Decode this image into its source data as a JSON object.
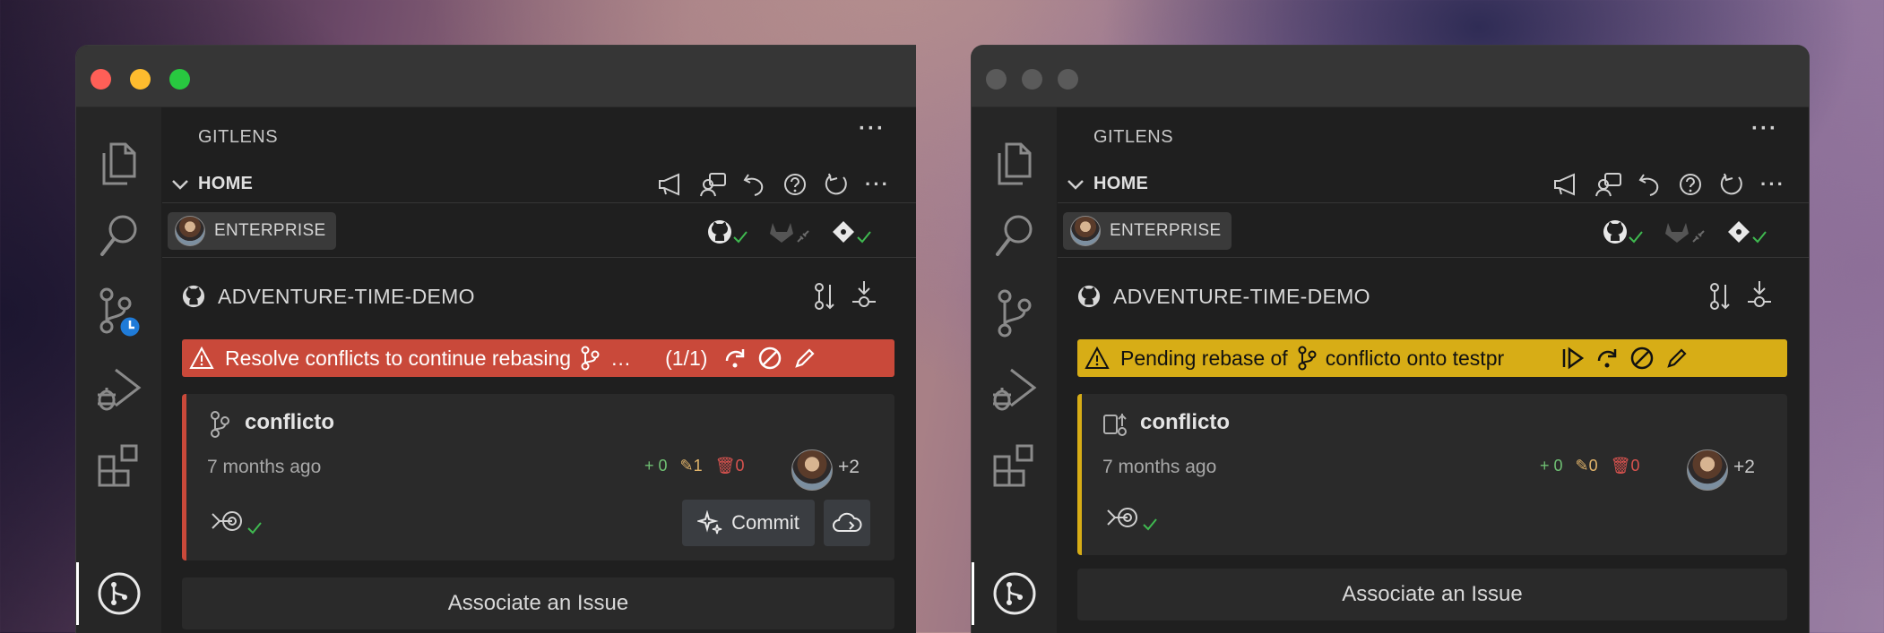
{
  "windows": [
    {
      "panel_title": "GITLENS",
      "section_label": "HOME",
      "account_label": "ENTERPRISE",
      "repo_name": "ADVENTURE-TIME-DEMO",
      "banner": {
        "text": "Resolve conflicts to continue rebasing",
        "extra": "…",
        "count": "(1/1)",
        "color": "#c9493a"
      },
      "branch": {
        "name": "conflicto",
        "time": "7 months ago",
        "added": "0",
        "modified": "1",
        "deleted": "0",
        "more": "+2"
      },
      "commit_label": "Commit",
      "associate_label": "Associate an Issue"
    },
    {
      "panel_title": "GITLENS",
      "section_label": "HOME",
      "account_label": "ENTERPRISE",
      "repo_name": "ADVENTURE-TIME-DEMO",
      "banner": {
        "prefix": "Pending rebase of",
        "branch": "conflicto onto testpr",
        "color": "#d7ad16"
      },
      "branch": {
        "name": "conflicto",
        "time": "7 months ago",
        "added": "0",
        "modified": "0",
        "deleted": "0",
        "more": "+2"
      },
      "associate_label": "Associate an Issue"
    }
  ],
  "icons": {
    "activity_bar": [
      "files-icon",
      "search-icon",
      "source-control-icon",
      "run-debug-icon",
      "extensions-icon",
      "gitlens-icon"
    ],
    "toolbar": [
      "megaphone-icon",
      "feedback-icon",
      "undo-icon",
      "help-icon",
      "refresh-icon",
      "more-icon"
    ]
  },
  "colors": {
    "added": "#6fbf73",
    "modified": "#e0b36a",
    "deleted": "#d9534f",
    "check": "#3fb950"
  }
}
